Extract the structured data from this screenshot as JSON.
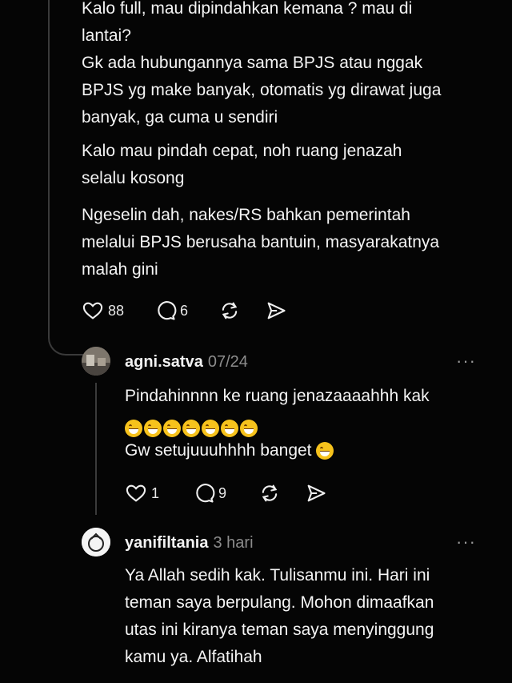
{
  "post1": {
    "lines": [
      "Kalo full, mau dipindahkan kemana ? mau di",
      "lantai?",
      "Gk ada hubungannya sama BPJS atau nggak",
      "BPJS yg make banyak, otomatis yg dirawat juga",
      "banyak, ga cuma u sendiri"
    ],
    "para2": [
      "Kalo mau pindah cepat, noh ruang jenazah",
      "selalu kosong"
    ],
    "para3": [
      "Ngeselin dah, nakes/RS bahkan pemerintah",
      "melalui BPJS berusaha bantuin, masyarakatnya",
      "malah gini"
    ],
    "likes": "88",
    "replies": "6"
  },
  "reply1": {
    "username": "agni.satva",
    "time": "07/24",
    "line1": "Pindahinnnn ke ruang jenazaaaahhh kak",
    "emoji_count": 7,
    "line3": "Gw setujuuuhhhh banget",
    "likes": "1",
    "replies": "9",
    "more": "···"
  },
  "reply2": {
    "username": "yanifiltania",
    "time": "3 hari",
    "lines": [
      "Ya Allah sedih kak. Tulisanmu ini. Hari ini",
      "teman saya berpulang. Mohon dimaafkan",
      "utas ini kiranya teman saya menyinggung",
      "kamu ya. Alfatihah"
    ],
    "more": "···"
  },
  "icons": {
    "like": "heart-icon",
    "reply": "comment-icon",
    "repost": "repost-icon",
    "share": "share-icon"
  },
  "colors": {
    "background": "#050505",
    "text": "#f4f4f4",
    "muted": "#8c8c8c",
    "emoji": "#f6c21c"
  }
}
